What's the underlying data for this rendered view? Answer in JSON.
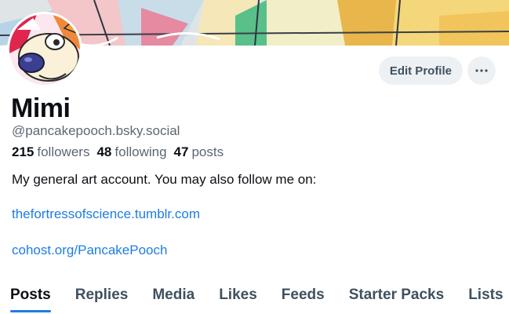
{
  "profile": {
    "display_name": "Mimi",
    "handle": "@pancakepooch.bsky.social",
    "bio": "My general art account. You may also follow me on:",
    "links": [
      "thefortressofscience.tumblr.com",
      "cohost.org/PancakePooch"
    ]
  },
  "stats": {
    "followers_count": "215",
    "followers_label": "followers",
    "following_count": "48",
    "following_label": "following",
    "posts_count": "47",
    "posts_label": "posts"
  },
  "actions": {
    "edit_profile_label": "Edit Profile",
    "more_icon": "ellipsis-icon"
  },
  "tabs": {
    "items": [
      "Posts",
      "Replies",
      "Media",
      "Likes",
      "Feeds",
      "Starter Packs",
      "Lists"
    ],
    "active": "Posts"
  },
  "colors": {
    "accent": "#1d7de4",
    "text": "#0b0f14",
    "muted": "#5b6775",
    "button_bg": "#eef1f4"
  }
}
